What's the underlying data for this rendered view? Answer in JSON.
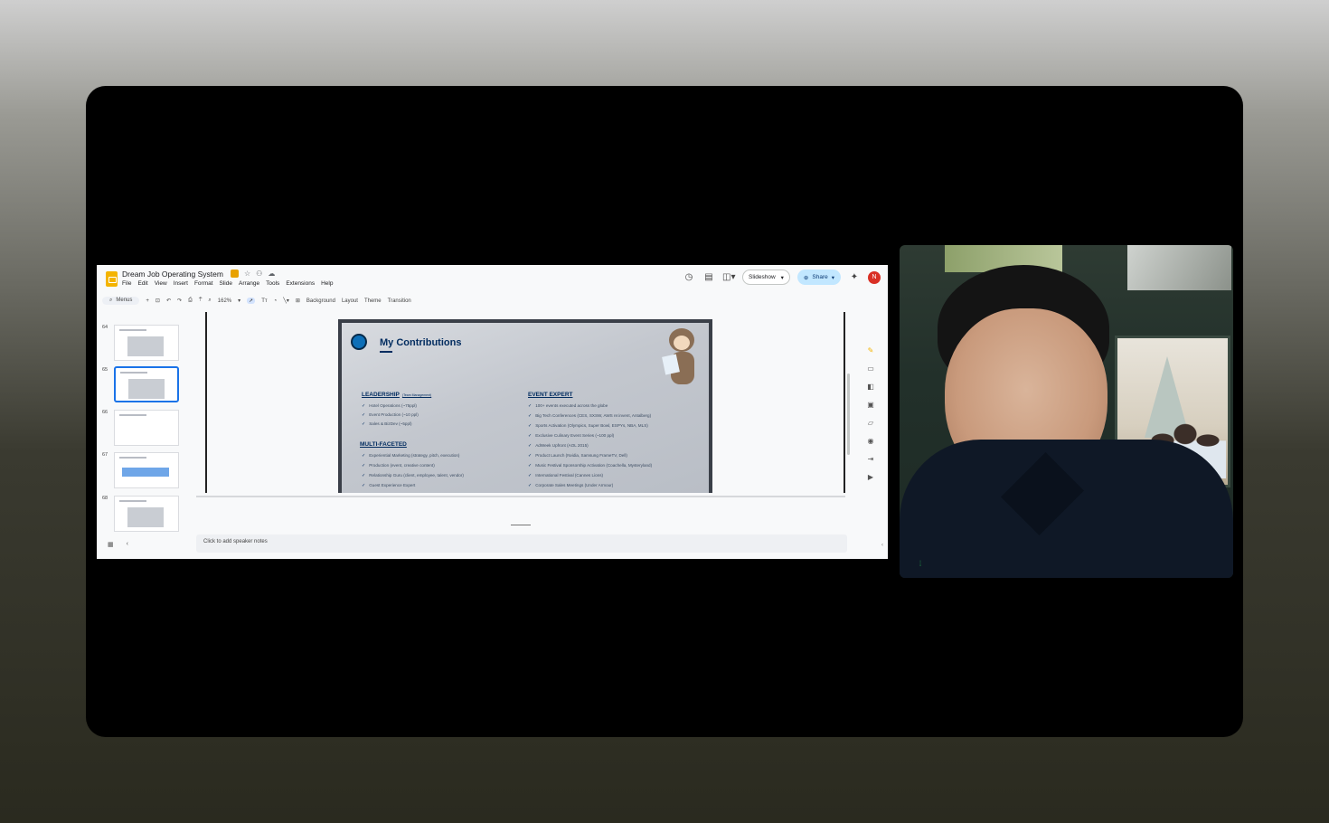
{
  "slides_app": {
    "doc_title": "Dream Job Operating System",
    "menu": [
      "File",
      "Edit",
      "View",
      "Insert",
      "Format",
      "Slide",
      "Arrange",
      "Tools",
      "Extensions",
      "Help"
    ],
    "slideshow_label": "Slideshow",
    "share_label": "Share",
    "avatar_initial": "N",
    "toolbar": {
      "menus_label": "Menus",
      "zoom": "162%",
      "background": "Background",
      "layout": "Layout",
      "theme": "Theme",
      "transition": "Transition"
    },
    "filmstrip": [
      {
        "num": "64"
      },
      {
        "num": "65",
        "active": true
      },
      {
        "num": "66"
      },
      {
        "num": "67"
      },
      {
        "num": "68"
      }
    ],
    "speaker_notes_placeholder": "Click to add speaker notes"
  },
  "slide": {
    "title": "My Contributions",
    "leadership": {
      "heading": "LEADERSHIP",
      "sub": "(Team Management)",
      "items": [
        "Hotel Operations (~75ppl)",
        "Event Production (~10 ppl)",
        "Sales & BizDev (~5ppl)"
      ]
    },
    "multifaceted": {
      "heading": "MULTI-FACETED",
      "items": [
        "Experiential Marketing (strategy, pitch, execution)",
        "Production (event, creative content)",
        "Relationship Guru (client, employee, talent, vendor)",
        "Guest Experience Expert"
      ]
    },
    "event_expert": {
      "heading": "EVENT EXPERT",
      "items": [
        "100+ events executed across the globe",
        "Big Tech Conferences (CES, SXSW, AWS re:invent, Antalberg)",
        "Sports Activation (Olympics, Super Bowl, ESPYs, NBA, MLS)",
        "Exclusive Culinary Event Series (~100 ppl)",
        "AdWeek Upfront (AOL 2015)",
        "Product Launch (Nvidia, Samsung FrameTV, Dell)",
        "Music Festival Sponsorship Activation (Coachella, Mysteryland)",
        "International Festival (Cannes Lions)",
        "Corporate Sales Meetings (Under Armour)"
      ]
    }
  },
  "icons": {
    "doc": "slides-logo-icon",
    "star": "star-icon",
    "history": "history-icon",
    "comments": "comment-icon",
    "meet": "video-camera-icon",
    "gemini": "sparkle-icon",
    "mic": "mic-active-icon"
  }
}
